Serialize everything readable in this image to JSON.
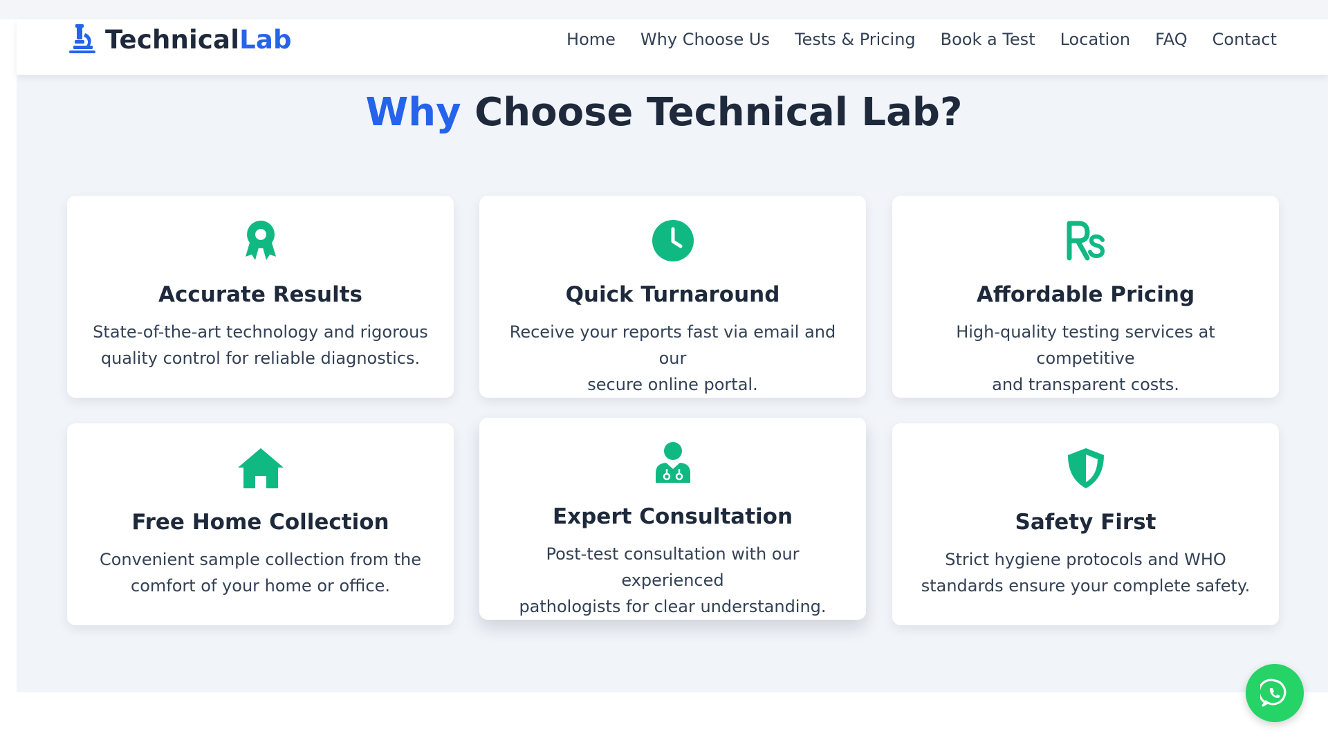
{
  "brand": {
    "name_part1": "Technical",
    "name_part2": "Lab",
    "icon": "microscope-icon",
    "accent_color": "#2563eb"
  },
  "nav": {
    "items": [
      {
        "label": "Home"
      },
      {
        "label": "Why Choose Us"
      },
      {
        "label": "Tests & Pricing"
      },
      {
        "label": "Book a Test"
      },
      {
        "label": "Location"
      },
      {
        "label": "FAQ"
      },
      {
        "label": "Contact"
      }
    ]
  },
  "section": {
    "title_accent": "Why",
    "title_rest": " Choose Technical Lab?",
    "icon_color": "#10b981"
  },
  "features": [
    {
      "icon": "award-icon",
      "title": "Accurate Results",
      "line1": "State-of-the-art technology and rigorous",
      "line2": "quality control for reliable diagnostics."
    },
    {
      "icon": "clock-icon",
      "title": "Quick Turnaround",
      "line1": "Receive your reports fast via email and our",
      "line2": "secure online portal."
    },
    {
      "icon": "rupee-icon",
      "title": "Affordable Pricing",
      "line1": "High-quality testing services at competitive",
      "line2": "and transparent costs."
    },
    {
      "icon": "home-icon",
      "title": "Free Home Collection",
      "line1": "Convenient sample collection from the",
      "line2": "comfort of your home or office."
    },
    {
      "icon": "doctor-icon",
      "title": "Expert Consultation",
      "line1": "Post-test consultation with our experienced",
      "line2": "pathologists for clear understanding."
    },
    {
      "icon": "shield-icon",
      "title": "Safety First",
      "line1": "Strict hygiene protocols and WHO",
      "line2": "standards ensure your complete safety."
    }
  ],
  "whatsapp": {
    "icon": "whatsapp-icon",
    "color": "#25d366"
  }
}
